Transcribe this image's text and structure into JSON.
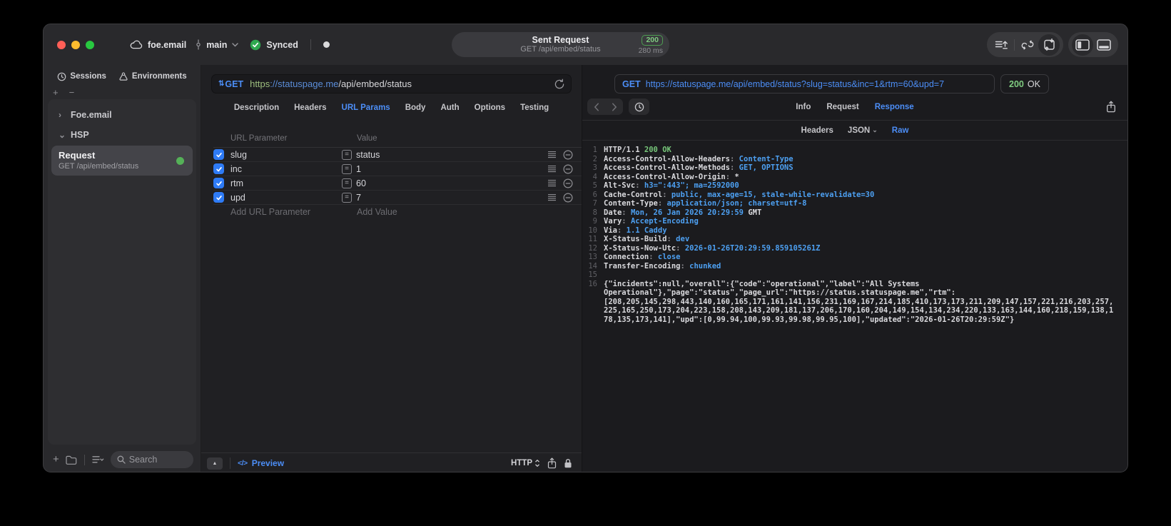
{
  "icons": {
    "method_arrows": "⇅",
    "chevron_right": "›",
    "chevron_down": "⌄",
    "collapse_triangle": "▲",
    "code_tag": "</>",
    "plus": "+",
    "minus": "−",
    "equals": "=",
    "back": "‹",
    "forward": "›"
  },
  "window": {
    "project": "foe.email",
    "branch": "main",
    "sync_label": "Synced",
    "center": {
      "title": "Sent Request",
      "subtitle": "GET /api/embed/status",
      "status_code": "200",
      "duration": "280 ms"
    }
  },
  "sidebar": {
    "tabs": [
      {
        "label": "Sessions"
      },
      {
        "label": "Environments"
      }
    ],
    "tree": [
      {
        "label": "Foe.email",
        "expanded": false
      },
      {
        "label": "HSP",
        "expanded": true
      }
    ],
    "request_item": {
      "title": "Request",
      "subtitle": "GET /api/embed/status"
    },
    "search_placeholder": "Search"
  },
  "request_editor": {
    "method": "GET",
    "url": {
      "scheme": "https",
      "host": "://statuspage.me",
      "path": "/api/embed/status"
    },
    "tabs": [
      "Description",
      "Headers",
      "URL Params",
      "Body",
      "Auth",
      "Options",
      "Testing"
    ],
    "active_tab": "URL Params",
    "params_table": {
      "headers": [
        "URL Parameter",
        "Value"
      ],
      "rows": [
        {
          "name": "slug",
          "value": "status",
          "checked": true
        },
        {
          "name": "inc",
          "value": "1",
          "checked": true
        },
        {
          "name": "rtm",
          "value": "60",
          "checked": true
        },
        {
          "name": "upd",
          "value": "7",
          "checked": true
        }
      ],
      "add_name_placeholder": "Add URL Parameter",
      "add_value_placeholder": "Add Value"
    },
    "footer": {
      "preview_label": "Preview",
      "protocol_label": "HTTP"
    }
  },
  "response_panel": {
    "request_line": {
      "method": "GET",
      "url": "https://statuspage.me/api/embed/status?slug=status&inc=1&rtm=60&upd=7"
    },
    "status": {
      "code": "200",
      "text": "OK"
    },
    "tabs": [
      "Info",
      "Request",
      "Response"
    ],
    "active_tab": "Response",
    "subtabs": [
      {
        "label": "Headers"
      },
      {
        "label": "JSON",
        "chevron": true
      },
      {
        "label": "Raw"
      }
    ],
    "active_subtab": "Raw",
    "code_lines": [
      {
        "no": 1,
        "segments": [
          {
            "t": "HTTP/1.1 ",
            "c": "w"
          },
          {
            "t": "200 OK",
            "c": "g"
          }
        ]
      },
      {
        "no": 2,
        "segments": [
          {
            "t": "Access-Control-Allow-Headers",
            "c": "w"
          },
          {
            "t": ": ",
            "c": "p"
          },
          {
            "t": "Content-Type",
            "c": "b"
          }
        ]
      },
      {
        "no": 3,
        "segments": [
          {
            "t": "Access-Control-Allow-Methods",
            "c": "w"
          },
          {
            "t": ": ",
            "c": "p"
          },
          {
            "t": "GET, OPTIONS",
            "c": "b"
          }
        ]
      },
      {
        "no": 4,
        "segments": [
          {
            "t": "Access-Control-Allow-Origin",
            "c": "w"
          },
          {
            "t": ": ",
            "c": "p"
          },
          {
            "t": "*",
            "c": "w"
          }
        ]
      },
      {
        "no": 5,
        "segments": [
          {
            "t": "Alt-Svc",
            "c": "w"
          },
          {
            "t": ": ",
            "c": "p"
          },
          {
            "t": "h3=\":443\"; ma=2592000",
            "c": "b"
          }
        ]
      },
      {
        "no": 6,
        "segments": [
          {
            "t": "Cache-Control",
            "c": "w"
          },
          {
            "t": ": ",
            "c": "p"
          },
          {
            "t": "public, max-age=15, stale-while-revalidate=30",
            "c": "b"
          }
        ]
      },
      {
        "no": 7,
        "segments": [
          {
            "t": "Content-Type",
            "c": "w"
          },
          {
            "t": ": ",
            "c": "p"
          },
          {
            "t": "application/json; charset=utf-8",
            "c": "b"
          }
        ]
      },
      {
        "no": 8,
        "segments": [
          {
            "t": "Date",
            "c": "w"
          },
          {
            "t": ": ",
            "c": "p"
          },
          {
            "t": "Mon, 26 Jan 2026 20:29:59 ",
            "c": "b"
          },
          {
            "t": "GMT",
            "c": "w"
          }
        ]
      },
      {
        "no": 9,
        "segments": [
          {
            "t": "Vary",
            "c": "w"
          },
          {
            "t": ": ",
            "c": "p"
          },
          {
            "t": "Accept-Encoding",
            "c": "b"
          }
        ]
      },
      {
        "no": 10,
        "segments": [
          {
            "t": "Via",
            "c": "w"
          },
          {
            "t": ": ",
            "c": "p"
          },
          {
            "t": "1.1 Caddy",
            "c": "b"
          }
        ]
      },
      {
        "no": 11,
        "segments": [
          {
            "t": "X-Status-Build",
            "c": "w"
          },
          {
            "t": ": ",
            "c": "p"
          },
          {
            "t": "dev",
            "c": "b"
          }
        ]
      },
      {
        "no": 12,
        "segments": [
          {
            "t": "X-Status-Now-Utc",
            "c": "w"
          },
          {
            "t": ": ",
            "c": "p"
          },
          {
            "t": "2026-01-26T20:29:59.859105261Z",
            "c": "b"
          }
        ]
      },
      {
        "no": 13,
        "segments": [
          {
            "t": "Connection",
            "c": "w"
          },
          {
            "t": ": ",
            "c": "p"
          },
          {
            "t": "close",
            "c": "b"
          }
        ]
      },
      {
        "no": 14,
        "segments": [
          {
            "t": "Transfer-Encoding",
            "c": "w"
          },
          {
            "t": ": ",
            "c": "p"
          },
          {
            "t": "chunked",
            "c": "b"
          }
        ]
      },
      {
        "no": 15,
        "segments": []
      },
      {
        "no": 16,
        "segments": [
          {
            "t": "{\"incidents\":null,\"overall\":{\"code\":\"operational\",\"label\":\"All Systems Operational\"},\"page\":\"status\",\"page_url\":\"https://status.statuspage.me\",\"rtm\":[208,205,145,298,443,140,160,165,171,161,141,156,231,169,167,214,185,410,173,173,211,209,147,157,221,216,203,257,225,165,250,173,204,223,158,208,143,209,181,137,206,170,160,204,149,154,134,234,220,133,163,144,160,218,159,138,178,135,173,141],\"upd\":[0,99.94,100,99.93,99.98,99.95,100],\"updated\":\"2026-01-26T20:29:59Z\"}",
            "c": "w"
          }
        ]
      }
    ]
  }
}
